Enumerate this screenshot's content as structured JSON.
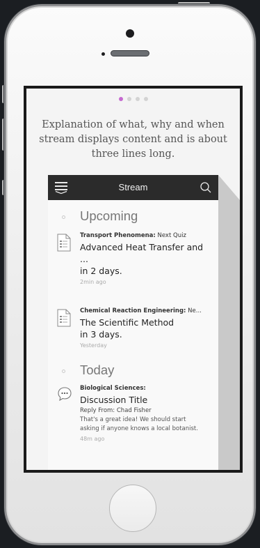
{
  "onboarding": {
    "page_dots": 4,
    "active_dot": 1,
    "explanation": "Explanation of what, why and when stream displays content and is about three lines long."
  },
  "app": {
    "title": "Stream",
    "sections": [
      {
        "label": "Upcoming",
        "items": [
          {
            "course": "Transport Phenomena:",
            "course_suffix": " Next Quiz",
            "title_line1": "Advanced Heat Transfer and ...",
            "title_line2": "in 2 days.",
            "time": "2min ago",
            "accent": "#e8c547",
            "icon": "document-icon"
          },
          {
            "course": "Chemical Reaction Engineering:",
            "course_suffix": " Ne...",
            "title_line1": "The Scientific Method",
            "title_line2": "in 3 days.",
            "time": "Yesterday",
            "accent": "#5fc07d",
            "icon": "document-icon"
          }
        ]
      },
      {
        "label": "Today",
        "items": [
          {
            "course": "Biological Sciences:",
            "title_line1": "Discussion Title",
            "reply": "Reply From: Chad Fisher",
            "body_line1": "That's a great idea! We should start",
            "body_line2": "asking if anyone knows a local botanist.",
            "time": "48m ago",
            "accent": "#c56ad0",
            "icon": "discussion-icon"
          }
        ]
      }
    ]
  },
  "colors": {
    "accent_active_dot": "#c56ad0",
    "header_bg": "#2b2b2b"
  }
}
